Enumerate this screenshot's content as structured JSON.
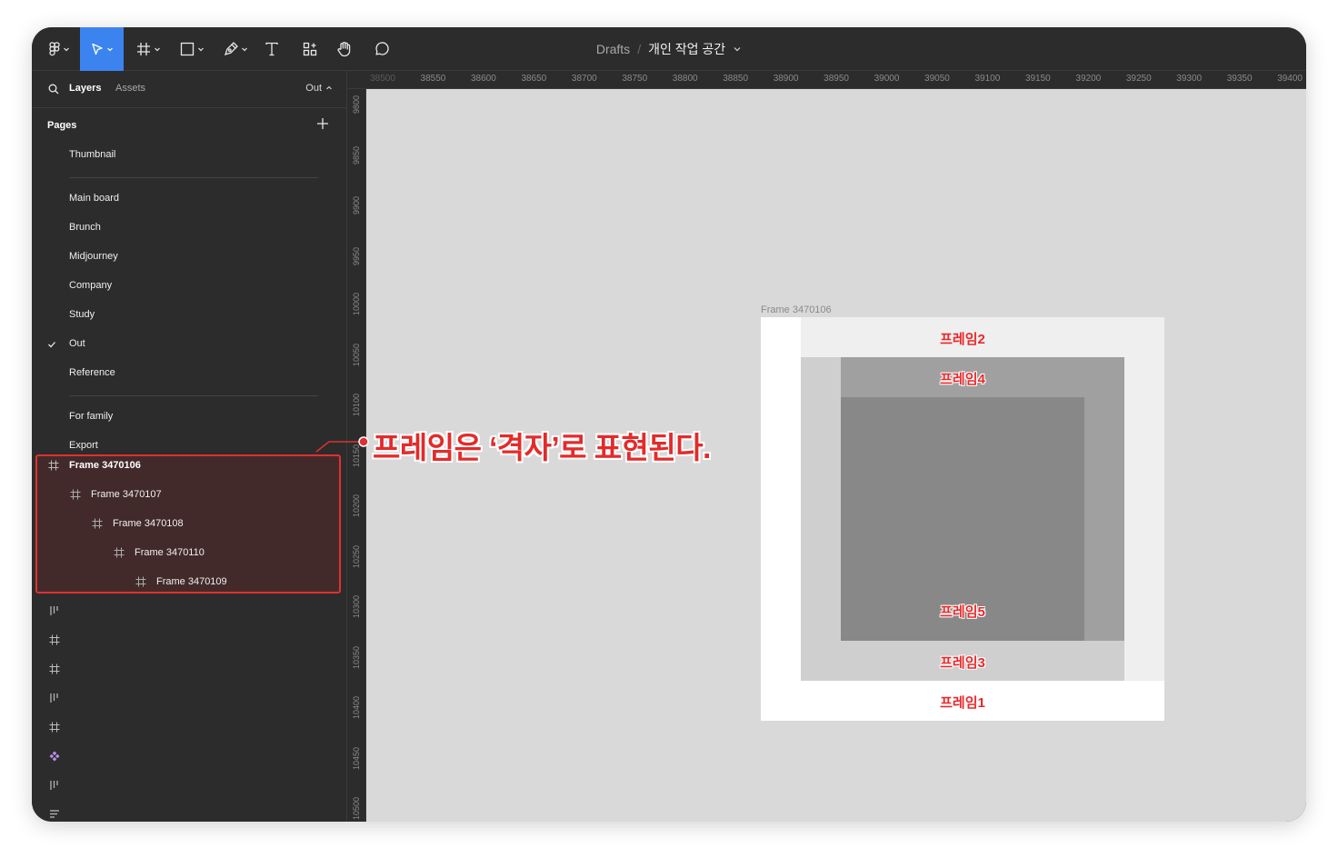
{
  "toolbar": {
    "tools": [
      {
        "name": "main-menu",
        "icon": "figma-logo-icon"
      },
      {
        "name": "move",
        "icon": "cursor-icon",
        "active": true
      },
      {
        "name": "frame",
        "icon": "hash-frame-icon"
      },
      {
        "name": "shape",
        "icon": "rectangle-icon"
      },
      {
        "name": "pen",
        "icon": "pen-icon"
      },
      {
        "name": "text",
        "icon": "text-icon"
      },
      {
        "name": "resources",
        "icon": "components-icon"
      },
      {
        "name": "hand",
        "icon": "hand-icon"
      },
      {
        "name": "comment",
        "icon": "comment-icon"
      }
    ],
    "breadcrumb": "Drafts",
    "separator": "/",
    "file_title": "개인 작업 공간"
  },
  "panel": {
    "tab_layers": "Layers",
    "tab_assets": "Assets",
    "current_page": "Out",
    "pages_heading": "Pages",
    "pages": [
      "Thumbnail",
      "Main board",
      "Brunch",
      "Midjourney",
      "Company",
      "Study",
      "Out",
      "Reference",
      "For family",
      "Export"
    ],
    "active_page": "Out",
    "layers": [
      {
        "name": "Frame 3470106",
        "depth": 0
      },
      {
        "name": "Frame 3470107",
        "depth": 1
      },
      {
        "name": "Frame 3470108",
        "depth": 2
      },
      {
        "name": "Frame 3470110",
        "depth": 3
      },
      {
        "name": "Frame 3470109",
        "depth": 4
      }
    ],
    "other_layer_icons": [
      "columns-icon",
      "hash-frame-icon",
      "hash-frame-icon",
      "columns-icon",
      "hash-frame-icon",
      "component-icon",
      "columns-icon",
      "rows-icon"
    ]
  },
  "rulers": {
    "x_ticks": [
      "38500",
      "38550",
      "38600",
      "38650",
      "38700",
      "38750",
      "38800",
      "38850",
      "38900",
      "38950",
      "39000",
      "39050",
      "39100",
      "39150",
      "39200",
      "39250",
      "39300",
      "39350",
      "39400"
    ],
    "y_ticks": [
      "9800",
      "9850",
      "9900",
      "9950",
      "10000",
      "10050",
      "10100",
      "10150",
      "10200",
      "10250",
      "10300",
      "10350",
      "10400",
      "10450",
      "10500"
    ]
  },
  "canvas": {
    "frame_label": "Frame 3470106",
    "labels": {
      "f1": "프레임1",
      "f2": "프레임2",
      "f3": "프레임3",
      "f4": "프레임4",
      "f5": "프레임5"
    }
  },
  "annotation": {
    "text": "프레임은 ‘격자’로 표현된다.",
    "color": "#e32b2b"
  },
  "colors": {
    "accent": "#3b84f0",
    "highlight": "#e03030",
    "panel_bg": "#2c2c2c",
    "canvas_bg": "#d9d9d9"
  }
}
